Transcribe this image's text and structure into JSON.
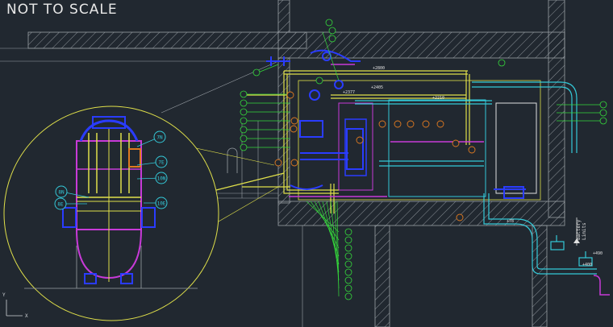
{
  "title": "NOT TO SCALE",
  "dimensions": {
    "top_run": "+2800",
    "mid_run_a": "+2377",
    "mid_run_b": "+2405",
    "right_run": "+2210",
    "lower_right": "+78",
    "far_right": "+400",
    "far_right_b": "+490"
  },
  "battery_limits": "Battery\nLimits",
  "detail_labels": [
    "7N",
    "7E",
    "10N",
    "10E",
    "8N",
    "8E"
  ],
  "colors": {
    "background": "#212830",
    "yellow": "#e0e04a",
    "cyan": "#34c9d8",
    "blue": "#2a3cff",
    "magenta": "#c83ad8",
    "green": "#35d83b",
    "orange": "#e07a20",
    "grey": "#9aa0a6"
  }
}
